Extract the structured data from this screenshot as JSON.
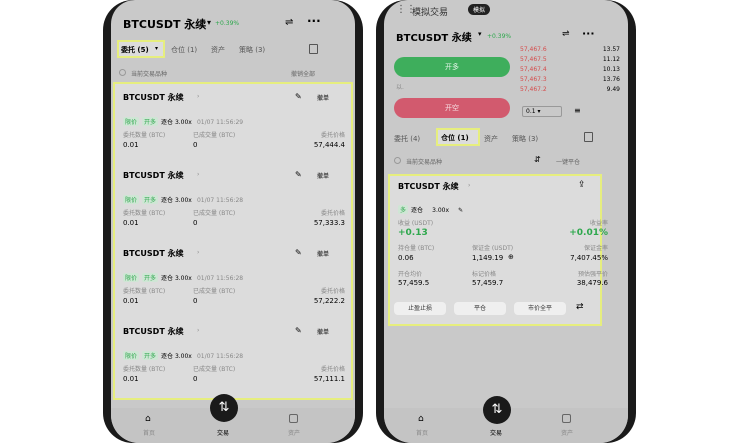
{
  "left": {
    "header": {
      "symbol": "BTCUSDT 永续",
      "change": "+0.39%"
    },
    "tabs": [
      "委托 (5)",
      "仓位 (1)",
      "资产",
      "策略 (3)"
    ],
    "subbar": {
      "left": "当前交易品种",
      "right": "撤销全部"
    },
    "orders": [
      {
        "symbol": "BTCUSDT 永续",
        "cancel": "撤单",
        "tag1": "限价",
        "tag2": "开多",
        "mode": "逐仓 3.00x",
        "time": "01/07 11:56:29",
        "h1": "委托数量 (BTC)",
        "h2": "已成交量 (BTC)",
        "h3": "委托价格",
        "v1": "0.01",
        "v2": "0",
        "v3": "57,444.4"
      },
      {
        "symbol": "BTCUSDT 永续",
        "cancel": "撤单",
        "tag1": "限价",
        "tag2": "开多",
        "mode": "逐仓 3.00x",
        "time": "01/07 11:56:28",
        "h1": "委托数量 (BTC)",
        "h2": "已成交量 (BTC)",
        "h3": "委托价格",
        "v1": "0.01",
        "v2": "0",
        "v3": "57,333.3"
      },
      {
        "symbol": "BTCUSDT 永续",
        "cancel": "撤单",
        "tag1": "限价",
        "tag2": "开多",
        "mode": "逐仓 3.00x",
        "time": "01/07 11:56:28",
        "h1": "委托数量 (BTC)",
        "h2": "已成交量 (BTC)",
        "h3": "委托价格",
        "v1": "0.01",
        "v2": "0",
        "v3": "57,222.2"
      },
      {
        "symbol": "BTCUSDT 永续",
        "cancel": "撤单",
        "tag1": "限价",
        "tag2": "开多",
        "mode": "逐仓 3.00x",
        "time": "01/07 11:56:28",
        "h1": "委托数量 (BTC)",
        "h2": "已成交量 (BTC)",
        "h3": "委托价格",
        "v1": "0.01",
        "v2": "0",
        "v3": "57,111.1"
      }
    ],
    "bottom_nav": [
      "首页",
      "交易",
      "资产"
    ]
  },
  "right": {
    "topbar": {
      "title": "模拟交易",
      "badge": "模拟"
    },
    "header": {
      "symbol": "BTCUSDT 永续",
      "change": "+0.39%"
    },
    "buy_button": "开多",
    "sell_button": "开空",
    "orderbook": [
      {
        "price": "57,467.6",
        "qty": "13.57"
      },
      {
        "price": "57,467.5",
        "qty": "11.12"
      },
      {
        "price": "57,467.4",
        "qty": "10.13"
      },
      {
        "price": "57,467.3",
        "qty": "13.76"
      },
      {
        "price": "57,467.2",
        "qty": "9.49"
      }
    ],
    "depth_select": "0.1",
    "tabs": [
      "委托 (4)",
      "仓位 (1)",
      "资产",
      "策略 (3)"
    ],
    "subbar": {
      "left": "当前交易品种",
      "right": "一键平仓"
    },
    "position": {
      "symbol": "BTCUSDT 永续",
      "tag1": "多",
      "mode": "逐仓",
      "leverage": "3.00x",
      "pnl_label": "收益 (USDT)",
      "pnl": "+0.13",
      "roe_label": "收益率",
      "roe": "+0.01%",
      "size_label": "持仓量 (BTC)",
      "size": "0.06",
      "margin_label": "保证金 (USDT)",
      "margin": "1,149.19",
      "ratio_label": "保证金率",
      "ratio": "7,407.45%",
      "entry_label": "开仓均价",
      "entry": "57,459.5",
      "mark_label": "标记价格",
      "mark": "57,459.7",
      "liq_label": "预估强平价",
      "liq": "38,479.6",
      "btn1": "止盈止损",
      "btn2": "平仓",
      "btn3": "市价全平"
    },
    "bottom_nav": [
      "首页",
      "交易",
      "资产"
    ]
  }
}
